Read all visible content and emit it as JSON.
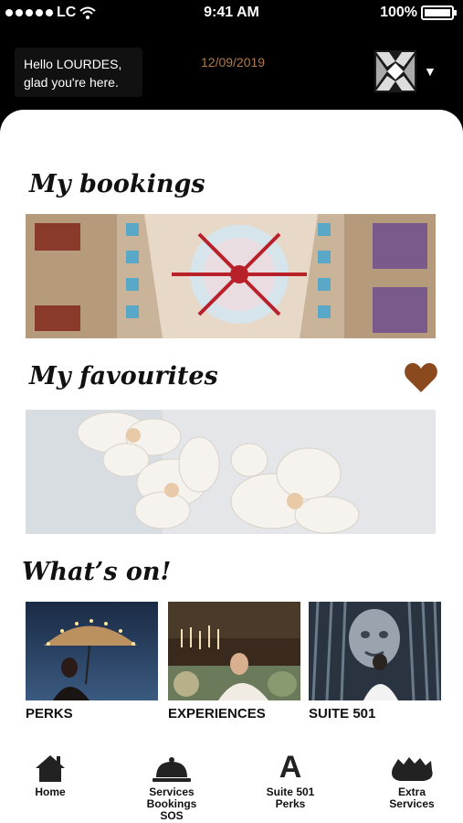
{
  "status_bar": {
    "carrier": "LC",
    "time": "9:41 AM",
    "battery": "100%"
  },
  "header": {
    "greeting_line1": "Hello LOURDES,",
    "greeting_line2": "glad you're here.",
    "date": "12/09/2019"
  },
  "sections": {
    "bookings_title": "My bookings",
    "favourites_title": "My favourites",
    "whats_on_title": "What’s on!"
  },
  "whats_on": [
    {
      "label": "PERKS"
    },
    {
      "label": "EXPERIENCES"
    },
    {
      "label": "SUITE 501"
    }
  ],
  "tabs": [
    {
      "line1": "Home",
      "line2": "",
      "line3": ""
    },
    {
      "line1": "Services",
      "line2": "Bookings",
      "line3": "SOS"
    },
    {
      "line1": "Suite 501",
      "line2": "Perks",
      "line3": ""
    },
    {
      "line1": "Extra",
      "line2": "Services",
      "line3": ""
    }
  ],
  "colors": {
    "accent": "#b07a4a",
    "heart": "#8b4a1e"
  }
}
